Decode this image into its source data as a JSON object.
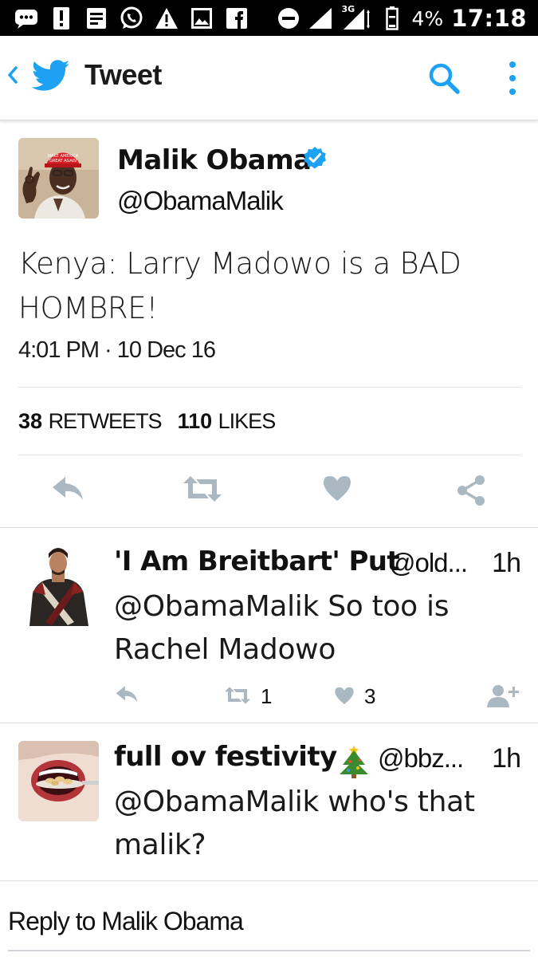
{
  "status_bar": {
    "network": "3G",
    "battery_percent": "4%",
    "time": "17:18",
    "icons": [
      "chat-icon",
      "alert-icon",
      "notes-icon",
      "whatsapp-icon",
      "warning-icon",
      "image-icon",
      "facebook-icon",
      "do-not-disturb-icon",
      "signal-icon",
      "signal-3g-icon",
      "battery-icon"
    ]
  },
  "app_bar": {
    "title": "Tweet",
    "icons": [
      "back-chevron-icon",
      "twitter-bird-icon",
      "search-icon",
      "more-vert-icon"
    ]
  },
  "tweet": {
    "author_name": "Malik Obama",
    "author_handle": "@ObamaMalik",
    "verified": true,
    "text": "Kenya: Larry Madowo is a BAD HOMBRE!",
    "timestamp": "4:01 PM · 10 Dec 16",
    "retweet_count": "38",
    "retweet_label": "RETWEETS",
    "like_count": "110",
    "like_label": "LIKES",
    "actions": [
      "reply-icon",
      "retweet-icon",
      "like-icon",
      "share-icon"
    ]
  },
  "replies": [
    {
      "name": "'I Am Breitbart' Put",
      "handle": "@old...",
      "time": "1h",
      "text": "@ObamaMalik So too is Rachel Madowo",
      "retweets": "1",
      "likes": "3"
    },
    {
      "name": "full ov festivity",
      "emoji": "🎄",
      "handle": "@bbz...",
      "time": "1h",
      "text": "@ObamaMalik who's that malik?"
    }
  ],
  "reply_bar": {
    "placeholder": "Reply to Malik Obama"
  },
  "colors": {
    "twitter_blue": "#1da1f2",
    "action_gray": "#aab8c2",
    "divider": "#e1e8ed"
  }
}
